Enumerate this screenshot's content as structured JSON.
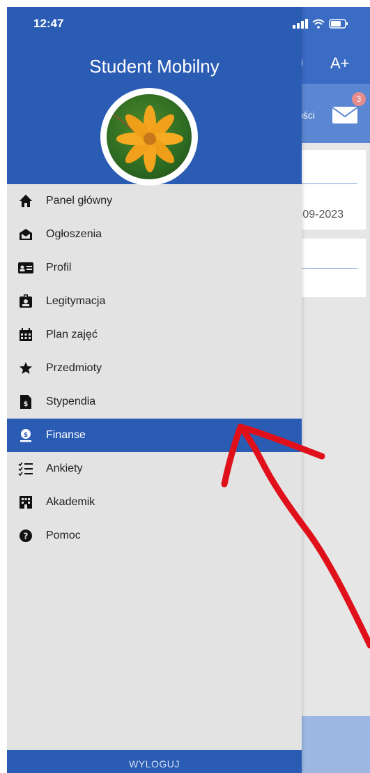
{
  "status_bar": {
    "time": "12:47"
  },
  "drawer": {
    "title": "Student Mobilny",
    "menu": [
      {
        "label": "Panel główny",
        "icon": "home-icon"
      },
      {
        "label": "Ogłoszenia",
        "icon": "envelope-open-icon"
      },
      {
        "label": "Profil",
        "icon": "id-card-icon"
      },
      {
        "label": "Legitymacja",
        "icon": "id-badge-icon"
      },
      {
        "label": "Plan zajęć",
        "icon": "calendar-icon"
      },
      {
        "label": "Przedmioty",
        "icon": "star-icon"
      },
      {
        "label": "Stypendia",
        "icon": "dollar-document-icon"
      },
      {
        "label": "Finanse",
        "icon": "money-user-icon",
        "active": true
      },
      {
        "label": "Ankiety",
        "icon": "checklist-icon"
      },
      {
        "label": "Akademik",
        "icon": "building-icon"
      },
      {
        "label": "Pomoc",
        "icon": "question-circle-icon"
      }
    ],
    "logout_label": "WYLOGUJ"
  },
  "background": {
    "font_size_label": "A+",
    "paren": ")",
    "messages_partial": "ości",
    "badge_count": "3",
    "date_partial": "-09-2023"
  },
  "colors": {
    "primary": "#2b5cb4",
    "drawer_bg": "#e3e3e3",
    "annotation": "#e0101a"
  }
}
